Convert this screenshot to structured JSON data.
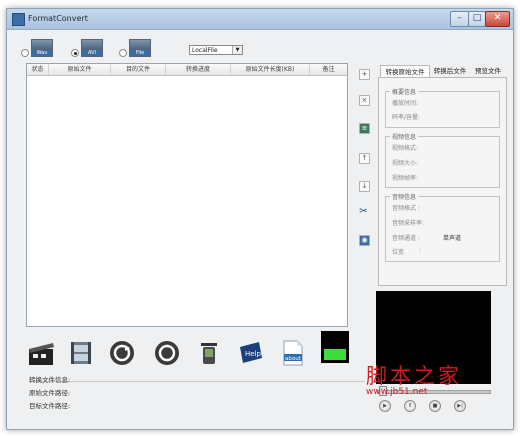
{
  "window": {
    "title": "FormatConvert"
  },
  "modes": {
    "option1_label": "Wav",
    "option2_label": "AVI",
    "option3_label": "File"
  },
  "source_select": {
    "value": "LocalFile"
  },
  "columns": [
    "状态",
    "原始文件",
    "目的文件",
    "转换进度",
    "原始文件长度(KB)",
    "备注"
  ],
  "tabs": [
    "转换原始文件",
    "转换后文件",
    "预览文件"
  ],
  "info": {
    "general": {
      "title": "概要信息",
      "duration": "播放时间:",
      "bitrate": "码率/容量:"
    },
    "video": {
      "title": "视频信息",
      "format": "视频格式:",
      "size": "视频大小:",
      "framerate": "视频帧率:"
    },
    "audio": {
      "title": "音频信息",
      "format": "音频格式 :",
      "samplerate": "音频采样率:",
      "channels_label": "音频通道 :",
      "channels_value": "单声道",
      "bits_label": "位宽",
      "bits_value": ":"
    }
  },
  "toolbar": {
    "help_label": "Help",
    "about_label": "about"
  },
  "status": {
    "convert_info": "转换文件信息:",
    "source_path": "原始文件路径:",
    "target_path": "目标文件路径:"
  },
  "watermark": {
    "title": "脚本之家",
    "url": "www.jb51.net"
  },
  "colors": {
    "progress_green": "#3ddc3d",
    "video_bg": "#000000"
  }
}
